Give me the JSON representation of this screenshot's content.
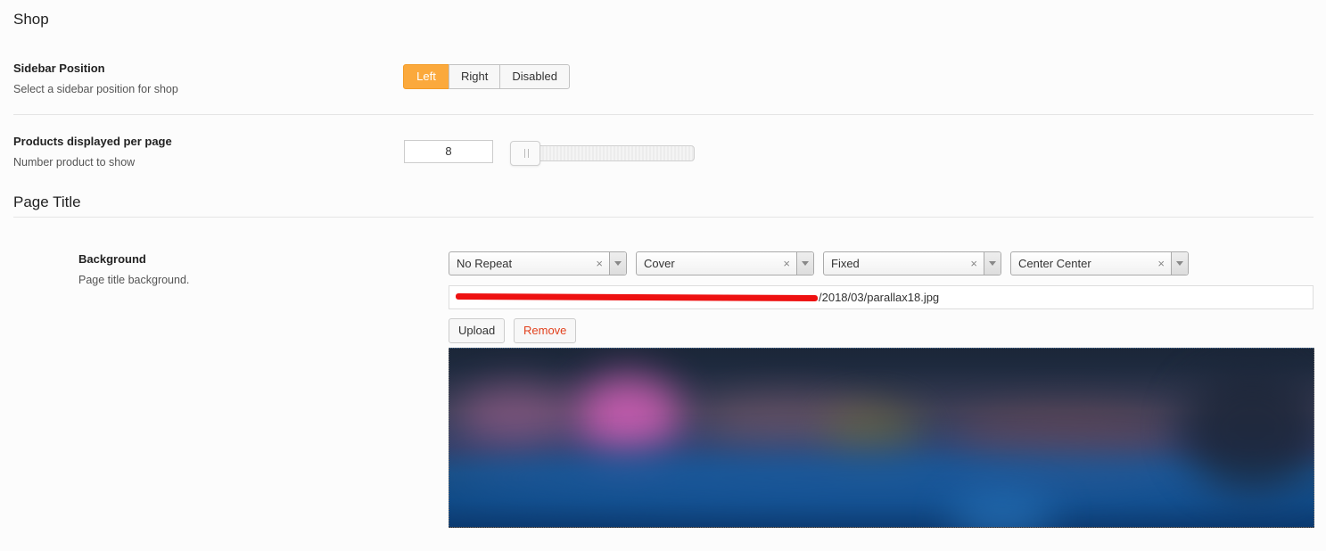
{
  "shop": {
    "section_title": "Shop",
    "sidebar_position": {
      "title": "Sidebar Position",
      "description": "Select a sidebar position for shop",
      "options": [
        "Left",
        "Right",
        "Disabled"
      ],
      "selected": "Left"
    },
    "products_per_page": {
      "title": "Products displayed per page",
      "description": "Number product to show",
      "value": "8"
    }
  },
  "page_title": {
    "section_title": "Page Title",
    "background": {
      "title": "Background",
      "description": "Page title background.",
      "repeat": "No Repeat",
      "size": "Cover",
      "attachment": "Fixed",
      "position": "Center Center",
      "clear_glyph": "×",
      "url_suffix": "/2018/03/parallax18.jpg",
      "upload_label": "Upload",
      "remove_label": "Remove"
    }
  },
  "colors": {
    "accent": "#fba93c",
    "remove_text": "#e2401c",
    "redaction": "#ee1111"
  }
}
